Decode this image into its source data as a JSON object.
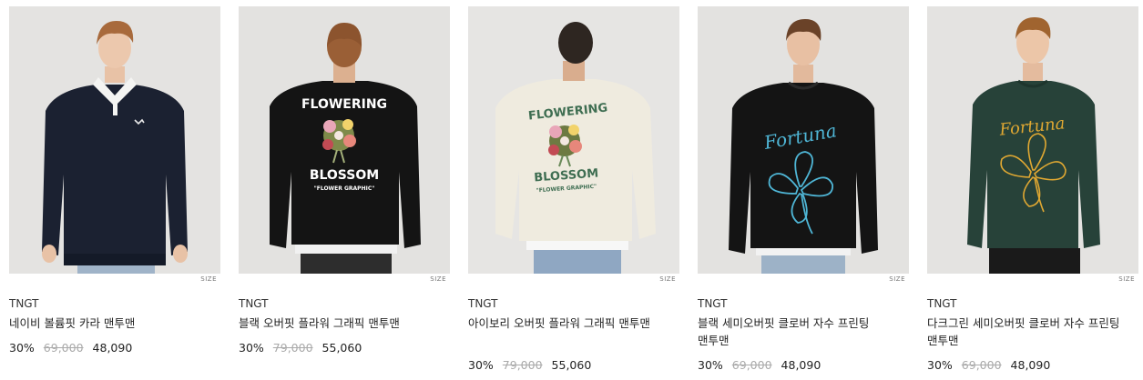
{
  "size_label": "SIZE",
  "products": [
    {
      "brand": "TNGT",
      "name": "네이비 볼륨핏 카라 맨투맨",
      "discount": "30%",
      "original_price": "69,000",
      "sale_price": "48,090",
      "background": "#e4e3e1",
      "garment_color": "#1b2131"
    },
    {
      "brand": "TNGT",
      "name": "블랙 오버핏 플라워 그래픽 맨투맨",
      "discount": "30%",
      "original_price": "79,000",
      "sale_price": "55,060",
      "background": "#e3e2e0",
      "garment_color": "#141414",
      "graphic_top": "FLOWERING",
      "graphic_bottom": "BLOSSOM",
      "graphic_caption": "\"FLOWER GRAPHIC\""
    },
    {
      "brand": "TNGT",
      "name": "아이보리 오버핏 플라워 그래픽 맨투맨",
      "discount": "30%",
      "original_price": "79,000",
      "sale_price": "55,060",
      "background": "#e6e5e3",
      "garment_color": "#efebdf",
      "graphic_top": "FLOWERING",
      "graphic_bottom": "BLOSSOM",
      "graphic_caption": "\"FLOWER GRAPHIC\""
    },
    {
      "brand": "TNGT",
      "name": "블랙 세미오버핏 클로버 자수 프린팅 맨투맨",
      "discount": "30%",
      "original_price": "69,000",
      "sale_price": "48,090",
      "background": "#e3e2e0",
      "garment_color": "#141414",
      "graphic_script": "Fortuna",
      "graphic_color": "#4fb6d6"
    },
    {
      "brand": "TNGT",
      "name": "다크그린 세미오버핏 클로버 자수 프린팅 맨투맨",
      "discount": "30%",
      "original_price": "69,000",
      "sale_price": "48,090",
      "background": "#e4e3e1",
      "garment_color": "#274239",
      "graphic_script": "Fortuna",
      "graphic_color": "#e0a832"
    }
  ]
}
